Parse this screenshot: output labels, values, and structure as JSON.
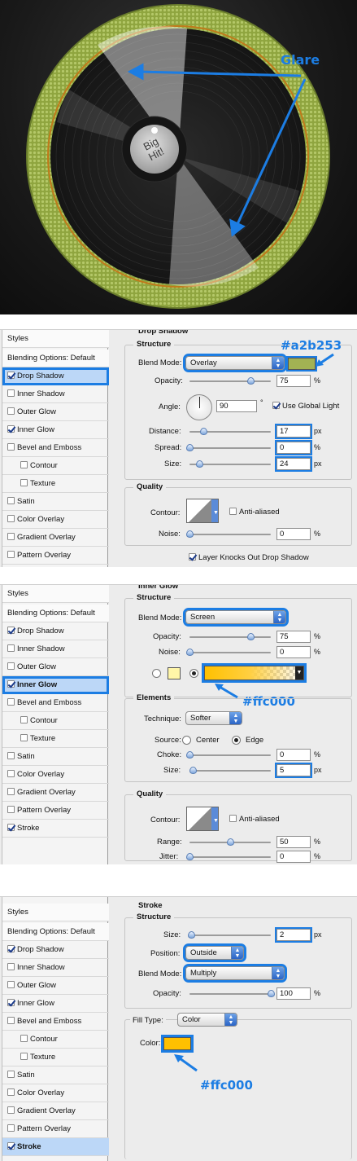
{
  "hero": {
    "glare_label": "Glare",
    "disc_label": "Big Hit!"
  },
  "sidebar": {
    "styles": "Styles",
    "blending": "Blending Options: Default",
    "items": [
      {
        "label": "Drop Shadow"
      },
      {
        "label": "Inner Shadow"
      },
      {
        "label": "Outer Glow"
      },
      {
        "label": "Inner Glow"
      },
      {
        "label": "Bevel and Emboss"
      },
      {
        "label": "Contour"
      },
      {
        "label": "Texture"
      },
      {
        "label": "Satin"
      },
      {
        "label": "Color Overlay"
      },
      {
        "label": "Gradient Overlay"
      },
      {
        "label": "Pattern Overlay"
      },
      {
        "label": "Stroke"
      }
    ]
  },
  "drop_shadow": {
    "title": "Drop Shadow",
    "structure": "Structure",
    "blend_mode_label": "Blend Mode:",
    "blend_mode": "Overlay",
    "color_annotation": "#a2b253",
    "color": "#a2b253",
    "opacity_label": "Opacity:",
    "opacity": "75",
    "opacity_level": 75,
    "angle_label": "Angle:",
    "angle": "90",
    "global_light": "Use Global Light",
    "distance_label": "Distance:",
    "distance": "17",
    "spread_label": "Spread:",
    "spread": "0",
    "size_label": "Size:",
    "size": "24",
    "quality": "Quality",
    "contour_label": "Contour:",
    "anti_aliased": "Anti-aliased",
    "noise_label": "Noise:",
    "noise": "0",
    "knocks_out": "Layer Knocks Out Drop Shadow",
    "unit_pct": "%",
    "unit_px": "px",
    "unit_deg": "°"
  },
  "inner_glow": {
    "title": "Inner Glow",
    "structure": "Structure",
    "blend_mode_label": "Blend Mode:",
    "blend_mode": "Screen",
    "opacity_label": "Opacity:",
    "opacity": "75",
    "noise_label": "Noise:",
    "noise": "0",
    "color_annotation": "#ffc000",
    "color": "#ffc000",
    "elements": "Elements",
    "technique_label": "Technique:",
    "technique": "Softer",
    "source_label": "Source:",
    "source_center": "Center",
    "source_edge": "Edge",
    "choke_label": "Choke:",
    "choke": "0",
    "size_label": "Size:",
    "size": "5",
    "quality": "Quality",
    "contour_label": "Contour:",
    "anti_aliased": "Anti-aliased",
    "range_label": "Range:",
    "range": "50",
    "jitter_label": "Jitter:",
    "jitter": "0",
    "unit_pct": "%",
    "unit_px": "px"
  },
  "stroke": {
    "title": "Stroke",
    "structure": "Structure",
    "size_label": "Size:",
    "size": "2",
    "position_label": "Position:",
    "position": "Outside",
    "blend_mode_label": "Blend Mode:",
    "blend_mode": "Multiply",
    "opacity_label": "Opacity:",
    "opacity": "100",
    "fill_type_label": "Fill Type:",
    "fill_type": "Color",
    "color_label": "Color:",
    "color": "#ffc000",
    "color_annotation": "#ffc000",
    "unit_pct": "%",
    "unit_px": "px"
  }
}
